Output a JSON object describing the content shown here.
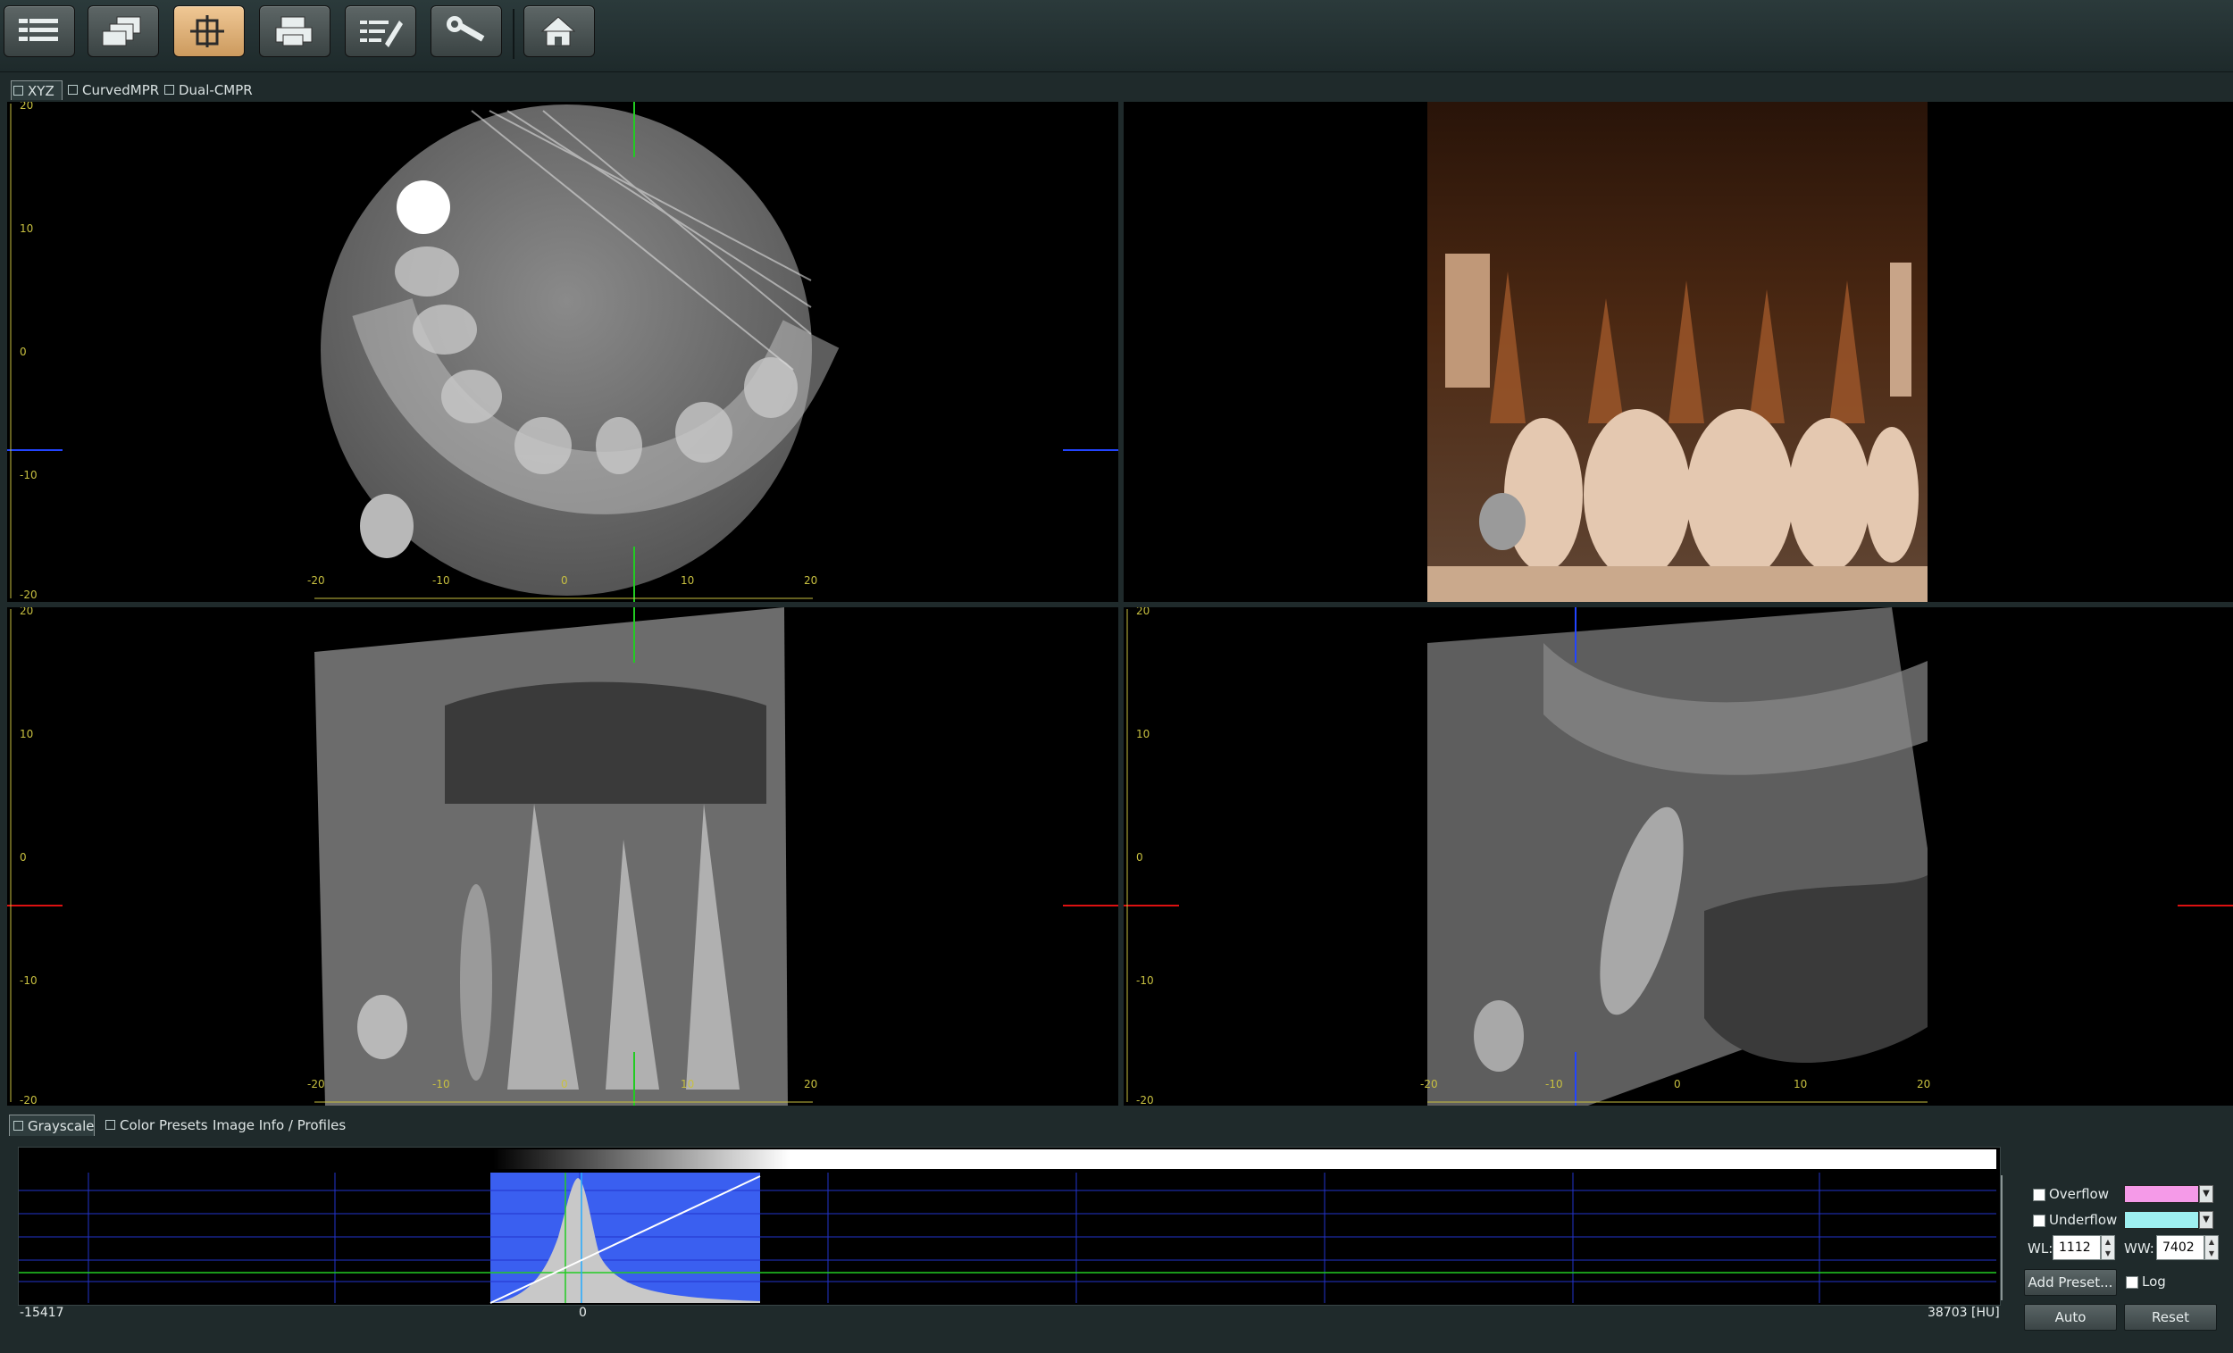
{
  "toolbar": {
    "buttons": [
      "list-icon",
      "layers-icon",
      "mpr-cube-icon",
      "print-icon",
      "edit-notes-icon",
      "wrench-icon",
      "home-icon"
    ],
    "active_index": 2
  },
  "view_tabs": [
    {
      "label": "XYZ",
      "active": true
    },
    {
      "label": "CurvedMPR",
      "active": false
    },
    {
      "label": "Dual-CMPR",
      "active": false
    }
  ],
  "viewports": {
    "axial": {
      "ruler_left": [
        "20",
        "10",
        "0",
        "-10",
        "-20"
      ],
      "ruler_bottom": [
        "-20",
        "-10",
        "0",
        "10",
        "20"
      ]
    },
    "volume_3d": {},
    "coronal": {
      "ruler_left": [
        "20",
        "10",
        "0",
        "-10",
        "-20"
      ],
      "ruler_bottom": [
        "-20",
        "-10",
        "0",
        "10",
        "20"
      ]
    },
    "sagittal": {
      "ruler_left": [
        "20",
        "10",
        "0",
        "-10",
        "-20"
      ],
      "ruler_bottom": [
        "-20",
        "-10",
        "0",
        "10",
        "20"
      ]
    }
  },
  "bottom_tabs": [
    {
      "label": "Grayscale",
      "active": true
    },
    {
      "label": "Color",
      "active": false
    },
    {
      "label": "Presets",
      "active": false
    },
    {
      "label": "Image Info / Profiles",
      "active": false
    }
  ],
  "histogram": {
    "min_label": "-15417",
    "zero_label": "0",
    "max_label": "38703 [HU]"
  },
  "controls": {
    "overflow_label": "Overflow",
    "overflow_color": "#f59ae8",
    "underflow_label": "Underflow",
    "underflow_color": "#9eeff0",
    "wl_label": "WL:",
    "wl_value": "1112",
    "ww_label": "WW:",
    "ww_value": "7402",
    "add_preset_label": "Add Preset...",
    "log_label": "Log",
    "auto_label": "Auto",
    "reset_label": "Reset"
  },
  "colors": {
    "crosshair_green": "#22cc22",
    "crosshair_blue": "#2244ff",
    "crosshair_red": "#dd1111",
    "ruler_text": "#c8c040",
    "histogram_window": "#3a5ff0"
  }
}
